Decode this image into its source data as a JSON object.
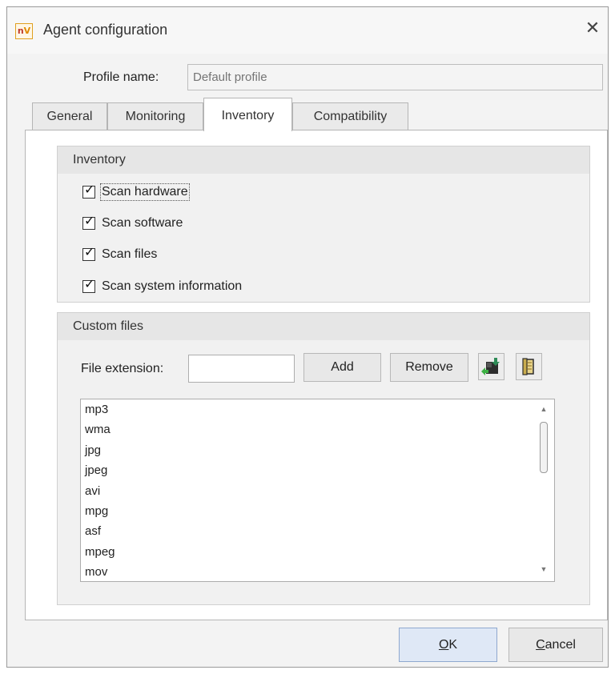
{
  "window": {
    "title": "Agent configuration",
    "icon_text_n": "n",
    "icon_text_v": "V",
    "close_glyph": "✕"
  },
  "profile": {
    "label": "Profile name:",
    "placeholder": "Default profile"
  },
  "tabs": [
    {
      "label": "General"
    },
    {
      "label": "Monitoring"
    },
    {
      "label": "Inventory",
      "active": true
    },
    {
      "label": "Compatibility"
    }
  ],
  "inventory": {
    "header": "Inventory",
    "options": [
      {
        "label": "Scan hardware",
        "checked": true
      },
      {
        "label": "Scan software",
        "checked": true
      },
      {
        "label": "Scan files",
        "checked": true
      },
      {
        "label": "Scan system information",
        "checked": true
      }
    ]
  },
  "custom_files": {
    "header": "Custom files",
    "extension_label": "File extension:",
    "extension_value": "",
    "add_label": "Add",
    "remove_label": "Remove",
    "import_icon": "import-icon",
    "export_icon": "export-icon",
    "extensions": [
      "mp3",
      "wma",
      "jpg",
      "jpeg",
      "avi",
      "mpg",
      "asf",
      "mpeg",
      "mov"
    ]
  },
  "footer": {
    "ok_underlined": "O",
    "ok_rest": "K",
    "cancel_underlined": "C",
    "cancel_rest": "ancel"
  },
  "colors": {
    "ok_button_bg": "#dfe8f6",
    "ok_button_border": "#8fa8cf"
  }
}
